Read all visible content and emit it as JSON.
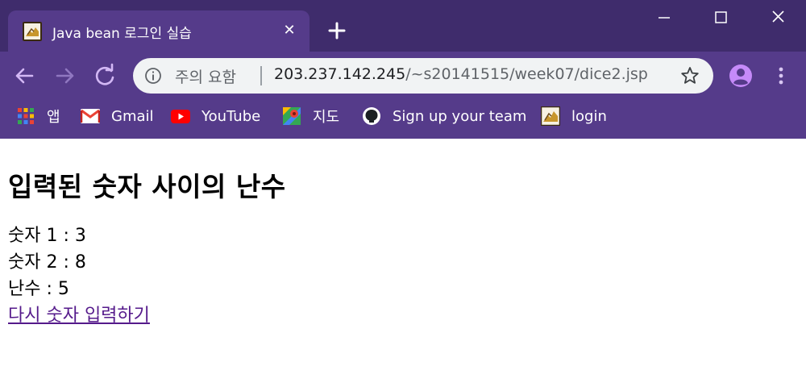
{
  "window": {
    "tab_title": "Java bean 로그인 실습",
    "tab_close_glyph": "✕",
    "new_tab_glyph": "+"
  },
  "address_bar": {
    "security_label": "주의 요함",
    "url_host": "203.237.142.245",
    "url_path": "/~s20141515/week07/dice2.jsp"
  },
  "bookmarks": [
    {
      "label": "앱",
      "icon": "apps-grid-icon"
    },
    {
      "label": "Gmail",
      "icon": "gmail-icon"
    },
    {
      "label": "YouTube",
      "icon": "youtube-icon"
    },
    {
      "label": "지도",
      "icon": "maps-pin-icon"
    },
    {
      "label": "Sign up your team",
      "icon": "github-icon"
    },
    {
      "label": "login",
      "icon": "site-favicon-icon"
    }
  ],
  "page": {
    "heading": "입력된 숫자 사이의 난수",
    "lines": [
      "숫자 1 : 3",
      "숫자 2 : 8",
      "난수 : 5"
    ],
    "link_text": "다시 숫자 입력하기"
  },
  "colors": {
    "tabstrip": "#3f2c6c",
    "toolbar": "#553b8a",
    "visited_link": "#551a8b",
    "accent_icon": "#c58af9"
  }
}
